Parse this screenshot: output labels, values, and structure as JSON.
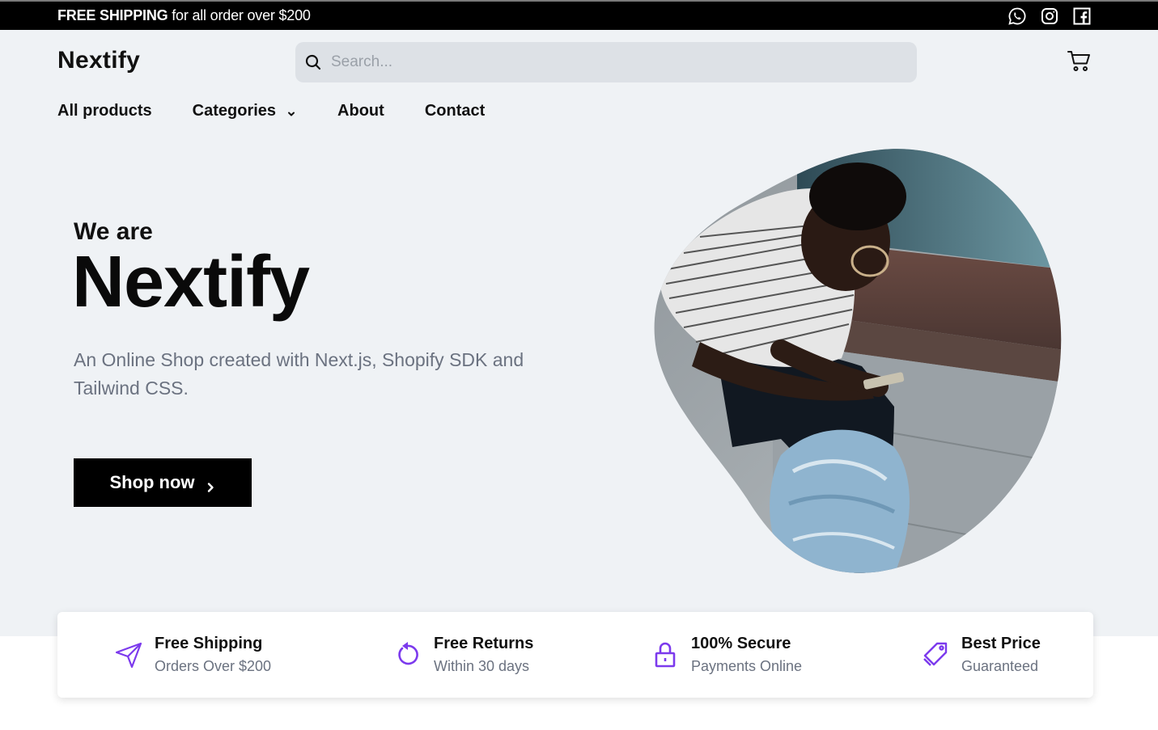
{
  "announcement": {
    "bold": "FREE SHIPPING",
    "rest": " for all order over $200"
  },
  "social": [
    "whatsapp-icon",
    "instagram-icon",
    "facebook-icon"
  ],
  "header": {
    "logo": "Nextify",
    "search_placeholder": "Search...",
    "cart_icon": "cart-icon"
  },
  "nav": {
    "items": [
      "All products",
      "Categories",
      "About",
      "Contact"
    ]
  },
  "hero": {
    "intro": "We are",
    "title": "Nextify",
    "subtitle": "An Online Shop created with Next.js, Shopify SDK and Tailwind CSS.",
    "cta": "Shop now"
  },
  "features": [
    {
      "title": "Free Shipping",
      "subtitle": "Orders Over $200",
      "icon": "paper-plane-icon"
    },
    {
      "title": "Free Returns",
      "subtitle": "Within 30 days",
      "icon": "return-icon"
    },
    {
      "title": "100% Secure",
      "subtitle": "Payments Online",
      "icon": "lock-icon"
    },
    {
      "title": "Best Price",
      "subtitle": "Guaranteed",
      "icon": "price-tag-icon"
    }
  ],
  "colors": {
    "accent": "#7c3aed",
    "hero_bg": "#eff2f5",
    "button_bg": "#000000"
  }
}
